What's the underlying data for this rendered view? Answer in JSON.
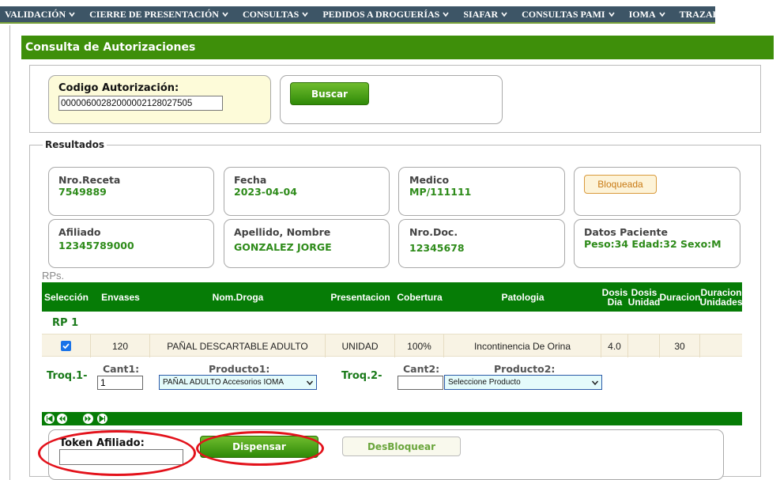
{
  "menu": {
    "items": [
      {
        "label": "VALIDACIÓN"
      },
      {
        "label": "CIERRE DE PRESENTACIÓN"
      },
      {
        "label": "CONSULTAS"
      },
      {
        "label": "PEDIDOS A DROGUERÍAS"
      },
      {
        "label": "SIAFAR"
      },
      {
        "label": "CONSULTAS PAMI"
      },
      {
        "label": "IOMA"
      },
      {
        "label": "TRAZABILIDAD"
      }
    ]
  },
  "page": {
    "title": "Consulta de Autorizaciones"
  },
  "search": {
    "code_label": "Codigo Autorización:",
    "code_value": "000006002820000021280275​05",
    "search_button": "Buscar"
  },
  "results": {
    "legend": "Resultados",
    "receta_label": "Nro.Receta",
    "receta_value": "7549889",
    "fecha_label": "Fecha",
    "fecha_value": "2023-04-04",
    "medico_label": "Medico",
    "medico_value": "MP/111111",
    "status_button": "Bloqueada",
    "afiliado_label": "Afiliado",
    "afiliado_value": "12345789000",
    "nombre_label": "Apellido, Nombre",
    "nombre_value": "GONZALEZ JORGE",
    "doc_label": "Nro.Doc.",
    "doc_value": "12345678",
    "paciente_label": "Datos Paciente",
    "paciente_value": "Peso:34 Edad:32 Sexo:M"
  },
  "rps": {
    "label": "RPs.",
    "columns": {
      "seleccion": "Selección",
      "envases": "Envases",
      "droga": "Nom.Droga",
      "presentacion": "Presentacion",
      "cobertura": "Cobertura",
      "patologia": "Patologia",
      "dosis_dia": "Dosis Dia",
      "dosis_unidad": "Dosis Unidad",
      "duracion": "Duracion",
      "duracion_unidades": "Duracion Unidades"
    },
    "rp_label": "RP 1",
    "row": {
      "selected": true,
      "envases": "120",
      "droga": "PAÑAL DESCARTABLE ADULTO",
      "presentacion": "UNIDAD",
      "cobertura": "100%",
      "patologia": "Incontinencia De Orina",
      "dosis_dia": "4.0",
      "dosis_unidad": "",
      "duracion": "30",
      "duracion_unidades": ""
    },
    "troq1_label": "Troq.1-",
    "cant1_label": "Cant1:",
    "cant1_value": "1",
    "producto1_label": "Producto1:",
    "producto1_value": "PAÑAL ADULTO Accesorios IOMA",
    "troq2_label": "Troq.2-",
    "cant2_label": "Cant2:",
    "cant2_value": "",
    "producto2_label": "Producto2:",
    "producto2_value": "Seleccione Producto"
  },
  "bottom": {
    "token_label": "Token Afiliado:",
    "token_value": "",
    "dispensar_button": "Dispensar",
    "desbloquear_button": "DesBloquear"
  },
  "colors": {
    "brand_green": "#3e8f0a",
    "grid_green": "#067c06",
    "menu_bg": "#3d5566",
    "highlight_red": "#e3121b"
  }
}
